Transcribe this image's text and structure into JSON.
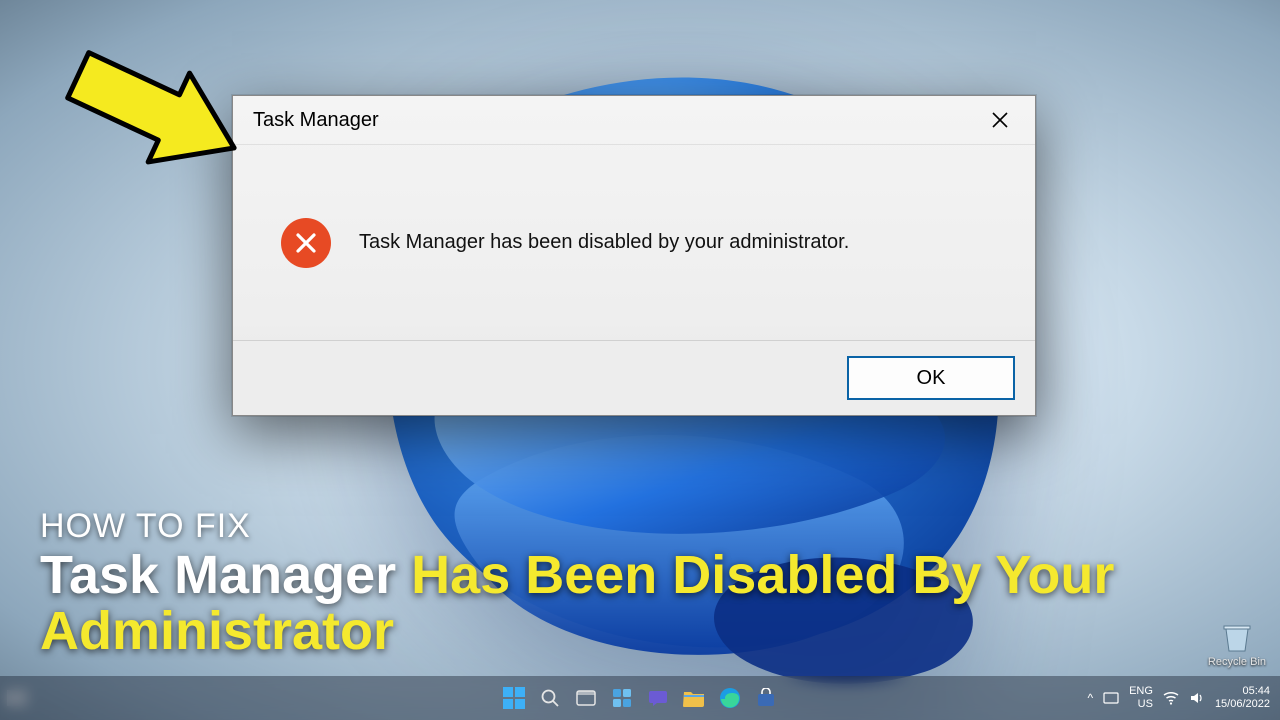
{
  "dialog": {
    "title": "Task Manager",
    "message": "Task Manager has been disabled by your administrator.",
    "ok_label": "OK"
  },
  "caption": {
    "line1": "HOW TO FIX",
    "line2_white": "Task Manager",
    "line2_yellow": "Has Been Disabled By Your Administrator"
  },
  "desktop": {
    "recycle_bin": "Recycle Bin"
  },
  "tray": {
    "lang1": "ENG",
    "lang2": "US",
    "time": "05:44",
    "date": "15/06/2022",
    "chevron": "^"
  },
  "icons": {
    "close": "close-icon",
    "error": "error-icon"
  },
  "colors": {
    "error_bg": "#e74a24",
    "ok_border": "#0a63a6",
    "arrow": "#f5ea1f"
  }
}
